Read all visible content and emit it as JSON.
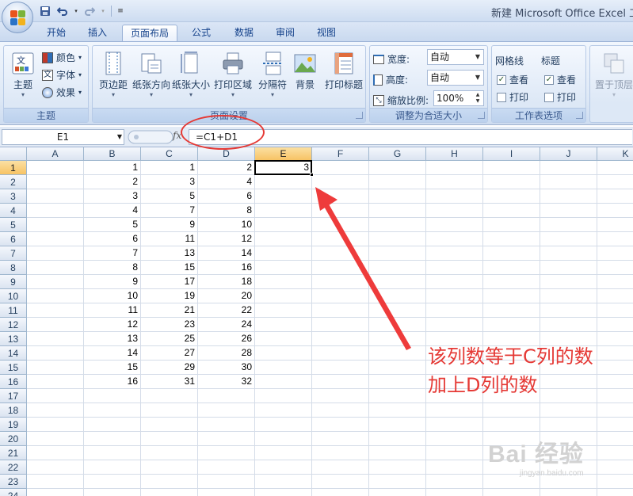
{
  "window": {
    "title": "新建 Microsoft Office Excel 工"
  },
  "tabs": [
    {
      "label": "开始",
      "active": false
    },
    {
      "label": "插入",
      "active": false
    },
    {
      "label": "页面布局",
      "active": true
    },
    {
      "label": "公式",
      "active": false
    },
    {
      "label": "数据",
      "active": false
    },
    {
      "label": "审阅",
      "active": false
    },
    {
      "label": "视图",
      "active": false
    }
  ],
  "ribbon": {
    "theme_group": {
      "label": "主题",
      "theme_button": "主题",
      "colors": "颜色",
      "fonts": "字体",
      "effects": "效果"
    },
    "page_setup_group": {
      "label": "页面设置",
      "buttons": [
        "页边距",
        "纸张方向",
        "纸张大小",
        "打印区域",
        "分隔符",
        "背景",
        "打印标题"
      ]
    },
    "scale_group": {
      "label": "调整为合适大小",
      "width_label": "宽度:",
      "width_value": "自动",
      "height_label": "高度:",
      "height_value": "自动",
      "scale_label": "缩放比例:",
      "scale_value": "100%"
    },
    "sheet_options_group": {
      "label": "工作表选项",
      "gridlines": "网格线",
      "headings": "标题",
      "view": "查看",
      "print": "打印"
    },
    "arrange_group": {
      "bring_front": "置于顶层"
    }
  },
  "formula_bar": {
    "name_box": "E1",
    "fx": "fx",
    "formula": "=C1+D1"
  },
  "sheet": {
    "columns": [
      "A",
      "B",
      "C",
      "D",
      "E",
      "F",
      "G",
      "H",
      "I",
      "J",
      "K"
    ],
    "rows": [
      "1",
      "2",
      "3",
      "4",
      "5",
      "6",
      "7",
      "8",
      "9",
      "10",
      "11",
      "12",
      "13",
      "14",
      "15",
      "16",
      "17",
      "18",
      "19",
      "20",
      "21",
      "22",
      "23",
      "24"
    ],
    "selected_column": "E",
    "selected_row": "1",
    "col_b": [
      "1",
      "2",
      "3",
      "4",
      "5",
      "6",
      "7",
      "8",
      "9",
      "10",
      "11",
      "12",
      "13",
      "14",
      "15",
      "16"
    ],
    "col_c": [
      "1",
      "3",
      "5",
      "7",
      "9",
      "11",
      "13",
      "15",
      "17",
      "19",
      "21",
      "23",
      "25",
      "27",
      "29",
      "31"
    ],
    "col_d": [
      "2",
      "4",
      "6",
      "8",
      "10",
      "12",
      "14",
      "16",
      "18",
      "20",
      "22",
      "24",
      "26",
      "28",
      "30",
      "32"
    ],
    "e1": "3"
  },
  "annotation": {
    "line1": "该列数等于C列的数",
    "line2": "加上D列的数",
    "color": "#e53935"
  },
  "watermark": {
    "main": "Bai 经验",
    "sub": "jingyan.baidu.com"
  }
}
